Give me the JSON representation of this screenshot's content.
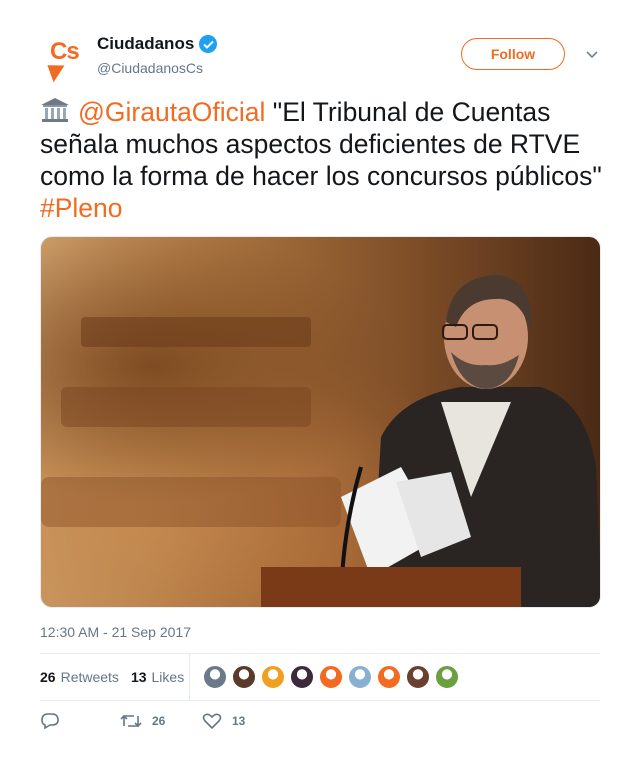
{
  "account": {
    "display_name": "Ciudadanos",
    "handle": "@CiudadanosCs",
    "logo_text": "Cs",
    "verified_icon": "verified-badge-icon"
  },
  "follow_button": {
    "label": "Follow"
  },
  "tweet": {
    "emoji": "🏛️",
    "mention": "@GirautaOficial",
    "text": " \"El Tribunal de Cuentas señala muchos aspectos deficientes de RTVE como la forma de hacer los concursos públicos\" ",
    "hashtag": "#Pleno"
  },
  "timestamp": "12:30 AM - 21 Sep 2017",
  "stats": {
    "retweets_count": "26",
    "retweets_label": "Retweets",
    "likes_count": "13",
    "likes_label": "Likes"
  },
  "liker_avatars": [
    {
      "color": "#6a7a8a"
    },
    {
      "color": "#5a3a2a"
    },
    {
      "color": "#f0a020"
    },
    {
      "color": "#3a2a3a"
    },
    {
      "color": "#f26b21"
    },
    {
      "color": "#8ab0d0"
    },
    {
      "color": "#f26b21"
    },
    {
      "color": "#6a4030"
    },
    {
      "color": "#6aa040"
    }
  ],
  "actions": {
    "reply_icon": "reply-icon",
    "retweet_icon": "retweet-icon",
    "retweet_count": "26",
    "like_icon": "heart-icon",
    "like_count": "13"
  },
  "colors": {
    "accent": "#f26b21",
    "verified": "#1da1f2",
    "muted": "#657786",
    "text": "#14171a"
  }
}
